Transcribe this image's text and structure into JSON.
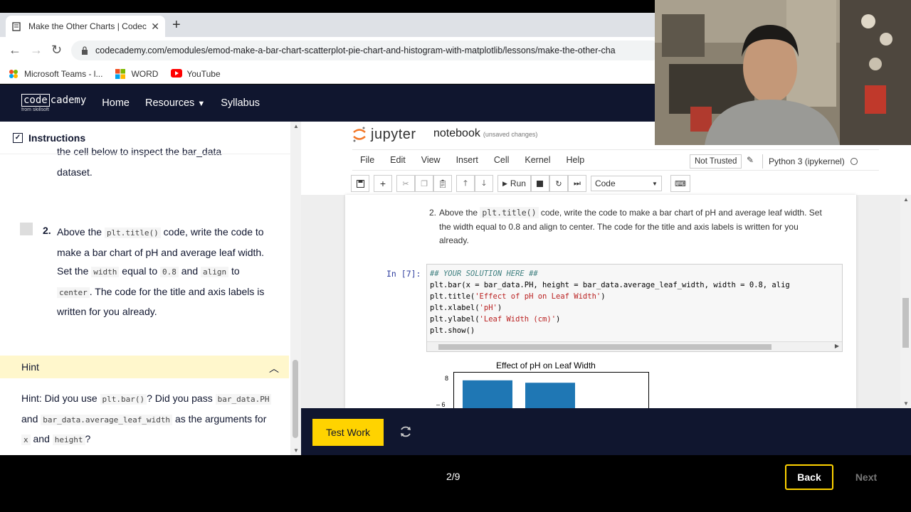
{
  "browser": {
    "tab_title": "Make the Other Charts | Codeca",
    "url": "codecademy.com/emodules/emod-make-a-bar-chart-scatterplot-pie-chart-and-histogram-with-matplotlib/lessons/make-the-other-cha",
    "bookmarks": [
      "Microsoft Teams - l...",
      "WORD",
      "YouTube"
    ]
  },
  "header": {
    "logo_main": "code",
    "logo_rest": "cademy",
    "logo_sub": "from skillsoft",
    "nav": [
      "Home",
      "Resources",
      "Syllabus"
    ]
  },
  "instructions": {
    "title": "Instructions",
    "cut_text": "the cell below to inspect the bar_data",
    "dataset": "dataset.",
    "step_number": "2.",
    "step_parts": [
      "Above the ",
      "plt.title()",
      " code, write the code to make a bar chart of pH and average leaf width. Set the ",
      "width",
      " equal to ",
      "0.8",
      " and ",
      "align",
      " to ",
      "center",
      ". The code for the title and axis labels is written for you already."
    ],
    "hint_label": "Hint",
    "hint_parts": [
      "Hint: Did you use ",
      "plt.bar()",
      "? Did you pass ",
      "bar_data.PH",
      " and ",
      "bar_data.average_leaf_width",
      " as the arguments for ",
      "x",
      " and ",
      "height",
      "?"
    ]
  },
  "jupyter": {
    "logo_text": "jupyter",
    "notebook_name": "notebook",
    "notebook_status": "(unsaved changes)",
    "menu": [
      "File",
      "Edit",
      "View",
      "Insert",
      "Cell",
      "Kernel",
      "Help"
    ],
    "trusted": "Not Trusted",
    "kernel": "Python 3 (ipykernel)",
    "run_label": "Run",
    "cell_type": "Code",
    "md_number": "2.",
    "md_parts": [
      "Above the ",
      "plt.title()",
      " code, write the code to make a bar chart of pH and average leaf width. Set the width equal to 0.8 and align to center. The code for the title and axis labels is written for you already."
    ],
    "prompt": "In [7]:",
    "code": {
      "comment": "## YOUR SOLUTION HERE ##",
      "line1": "plt.bar(x = bar_data.PH, height = bar_data.average_leaf_width, width = 0.8, alig",
      "line2a": "plt.title(",
      "line2s": "'Effect of pH on Leaf Width'",
      "line2b": ")",
      "line3a": "plt.xlabel(",
      "line3s": "'pH'",
      "line3b": ")",
      "line4a": "plt.ylabel(",
      "line4s": "'Leaf Width (cm)'",
      "line4b": ")",
      "line5": "plt.show()"
    },
    "plot_title": "Effect of pH on Leaf Width",
    "ytick_top": "8",
    "ytick_low": "6"
  },
  "chart_data": {
    "type": "bar",
    "title": "Effect of pH on Leaf Width",
    "categories": [
      "",
      ""
    ],
    "values": [
      8,
      7.9
    ],
    "ylim": [
      6.5,
      8.2
    ],
    "color": "#1f77b4"
  },
  "actions": {
    "test_work": "Test Work",
    "progress": "2/9",
    "back": "Back",
    "next": "Next"
  },
  "colors": {
    "brand_dark": "#10162f",
    "accent_yellow": "#ffd300",
    "hint_bg": "#fff7cc"
  }
}
